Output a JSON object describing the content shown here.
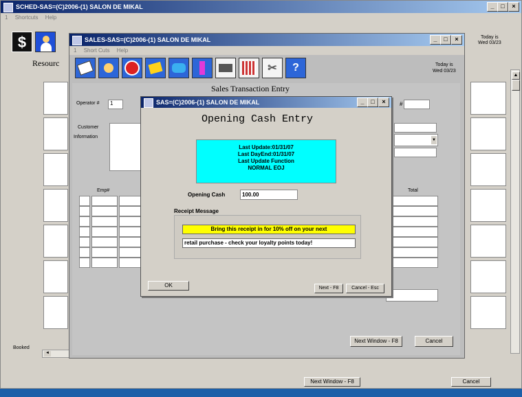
{
  "outer": {
    "title": "SCHED-SAS=(C)2006-(1) SALON DE MIKAL",
    "menu": [
      "1",
      "Shortcuts",
      "Help"
    ],
    "today_label": "Today is",
    "today_value": "Wed 03/23",
    "resource_label": "Resourc",
    "booked_label": "Booked",
    "next_window": "Next Window - F8",
    "cancel": "Cancel"
  },
  "sales": {
    "title": "SALES-SAS=(C)2006-(1) SALON DE MIKAL",
    "menu": [
      "1",
      "Short Cuts",
      "Help"
    ],
    "today_label": "Today is",
    "today_value": "Wed 03/23",
    "form_title": "Sales Transaction Entry",
    "operator_label": "Operator #",
    "operator_value": "1",
    "hash": "#",
    "customer_label": "Customer",
    "information_label": "Information",
    "col_emp": "Emp#",
    "col_total": "Total",
    "next_window": "Next Window - F8",
    "cancel": "Cancel"
  },
  "dialog": {
    "title": "SAS=(C)2006-(1) SALON DE MIKAL",
    "heading": "Opening Cash Entry",
    "status_line1": "Last Update:01/31/07",
    "status_line2": "Last DayEnd:01/31/07",
    "status_line3": "Last Update Function",
    "status_line4": "NORMAL EOJ",
    "cash_label": "Opening Cash",
    "cash_value": "100.00",
    "receipt_label": "Receipt Message",
    "receipt_line1": "Bring this receipt in for 10% off on your next",
    "receipt_line2": "retail purchase - check your loyalty points today!",
    "ok": "OK",
    "next": "Next - F8",
    "cancel": "Cancel - Esc"
  },
  "colors": {
    "title_blue": "#0a246a",
    "status_cyan": "#00ffff",
    "receipt_yellow": "#ffff00",
    "taskbar_blue": "#1c5fa8"
  },
  "icons": [
    "dollar-icon",
    "person-icon",
    "notebook-icon",
    "alarm-clock-icon",
    "sticky-note-icon",
    "shirts-icon",
    "nail-polish-icon",
    "hair-tools-icon",
    "calendar-grid-icon",
    "scissors-icon",
    "help-icon"
  ]
}
